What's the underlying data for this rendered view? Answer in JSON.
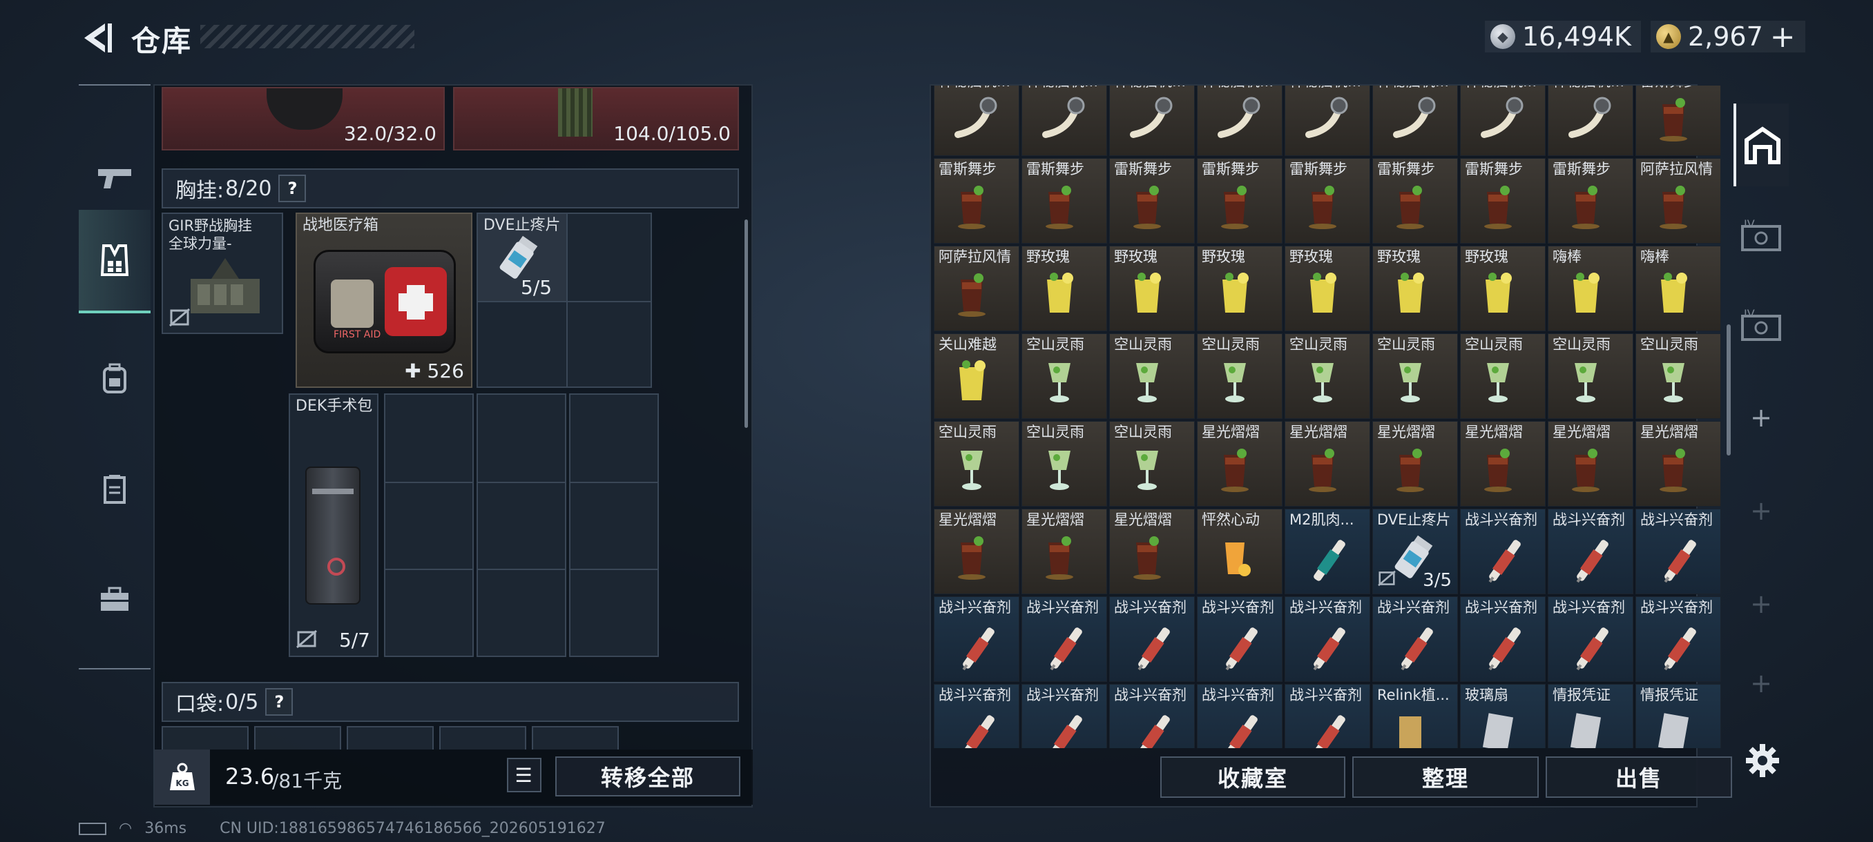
{
  "header": {
    "title": "仓库",
    "silver": "16,494K",
    "gold": "2,967",
    "gold_plus": "+"
  },
  "left": {
    "top_items": [
      {
        "value": "32.0/32.0"
      },
      {
        "value": "104.0/105.0"
      }
    ],
    "chest_section": {
      "label": "胸挂: ",
      "count": "8/20",
      "help": "?"
    },
    "rig": {
      "name": "GIR野战胸挂",
      "sub": "全球力量-"
    },
    "first_aid": {
      "name": "战地医疗箱",
      "count": "526",
      "plus": "✚",
      "kit_text": "FIRST AID"
    },
    "painkiller": {
      "name": "DVE止疼片",
      "count": "5/5"
    },
    "surgery": {
      "name": "DEK手术包",
      "count": "5/7"
    },
    "pocket_section": {
      "label": "口袋: ",
      "count": "0/5",
      "help": "?"
    },
    "weight": {
      "current": "23.6",
      "max": "/81千克",
      "icon": "KG"
    },
    "transfer_all": "转移全部"
  },
  "right": {
    "rows": [
      {
        "bg": "brown",
        "items": [
          {
            "n": "神秘脑机..."
          },
          {
            "n": "神秘脑机..."
          },
          {
            "n": "神秘脑机..."
          },
          {
            "n": "神秘脑机..."
          },
          {
            "n": "神秘脑机..."
          },
          {
            "n": "神秘脑机..."
          },
          {
            "n": "神秘脑机..."
          },
          {
            "n": "神秘脑机..."
          },
          {
            "n": "雷斯舞步"
          }
        ]
      },
      {
        "bg": "brown",
        "items": [
          {
            "n": "雷斯舞步"
          },
          {
            "n": "雷斯舞步"
          },
          {
            "n": "雷斯舞步"
          },
          {
            "n": "雷斯舞步"
          },
          {
            "n": "雷斯舞步"
          },
          {
            "n": "雷斯舞步"
          },
          {
            "n": "雷斯舞步"
          },
          {
            "n": "雷斯舞步"
          },
          {
            "n": "阿萨拉风情"
          }
        ]
      },
      {
        "bg": "brown",
        "items": [
          {
            "n": "阿萨拉风情"
          },
          {
            "n": "野玫瑰"
          },
          {
            "n": "野玫瑰"
          },
          {
            "n": "野玫瑰"
          },
          {
            "n": "野玫瑰"
          },
          {
            "n": "野玫瑰"
          },
          {
            "n": "野玫瑰"
          },
          {
            "n": "嗨棒"
          },
          {
            "n": "嗨棒"
          }
        ]
      },
      {
        "bg": "brown",
        "items": [
          {
            "n": "关山难越"
          },
          {
            "n": "空山灵雨"
          },
          {
            "n": "空山灵雨"
          },
          {
            "n": "空山灵雨"
          },
          {
            "n": "空山灵雨"
          },
          {
            "n": "空山灵雨"
          },
          {
            "n": "空山灵雨"
          },
          {
            "n": "空山灵雨"
          },
          {
            "n": "空山灵雨"
          }
        ]
      },
      {
        "bg": "brown",
        "items": [
          {
            "n": "空山灵雨"
          },
          {
            "n": "空山灵雨"
          },
          {
            "n": "空山灵雨"
          },
          {
            "n": "星光熠熠"
          },
          {
            "n": "星光熠熠"
          },
          {
            "n": "星光熠熠"
          },
          {
            "n": "星光熠熠"
          },
          {
            "n": "星光熠熠"
          },
          {
            "n": "星光熠熠"
          }
        ]
      },
      {
        "bg": "mixed",
        "items": [
          {
            "n": "星光熠熠"
          },
          {
            "n": "星光熠熠"
          },
          {
            "n": "星光熠熠"
          },
          {
            "n": "怦然心动"
          },
          {
            "n": "M2肌肉..."
          },
          {
            "n": "DVE止疼片",
            "c": "3/5"
          },
          {
            "n": "战斗兴奋剂"
          },
          {
            "n": "战斗兴奋剂"
          },
          {
            "n": "战斗兴奋剂"
          }
        ]
      },
      {
        "bg": "blue",
        "items": [
          {
            "n": "战斗兴奋剂"
          },
          {
            "n": "战斗兴奋剂"
          },
          {
            "n": "战斗兴奋剂"
          },
          {
            "n": "战斗兴奋剂"
          },
          {
            "n": "战斗兴奋剂"
          },
          {
            "n": "战斗兴奋剂"
          },
          {
            "n": "战斗兴奋剂"
          },
          {
            "n": "战斗兴奋剂"
          },
          {
            "n": "战斗兴奋剂"
          }
        ]
      },
      {
        "bg": "blue",
        "items": [
          {
            "n": "战斗兴奋剂"
          },
          {
            "n": "战斗兴奋剂"
          },
          {
            "n": "战斗兴奋剂"
          },
          {
            "n": "战斗兴奋剂"
          },
          {
            "n": "战斗兴奋剂"
          },
          {
            "n": "Relink植..."
          },
          {
            "n": "玻璃扇"
          },
          {
            "n": "情报凭证"
          },
          {
            "n": "情报凭证"
          }
        ]
      }
    ],
    "buttons": {
      "collection": "收藏室",
      "sort": "整理",
      "sell": "出售"
    },
    "tab_level_1": "IV",
    "tab_level_2": "IV",
    "tab_add": "+"
  },
  "status": {
    "ping": "36ms",
    "uid": "CN UID:188165986574746186566_202605191627"
  }
}
